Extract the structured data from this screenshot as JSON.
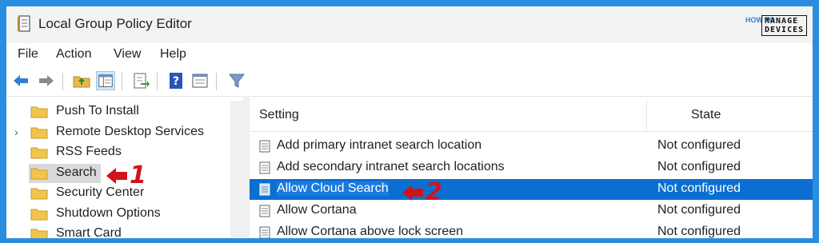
{
  "window": {
    "title": "Local Group Policy Editor",
    "brand_small": "HOW TO",
    "brand_box": "MANAGE DEVICES"
  },
  "menu": {
    "items": [
      "File",
      "Action",
      "View",
      "Help"
    ]
  },
  "toolbar": {
    "icons": [
      "back-arrow-icon",
      "forward-arrow-icon",
      "up-folder-icon",
      "show-hide-tree-icon",
      "export-list-icon",
      "help-icon",
      "properties-icon",
      "filter-icon"
    ]
  },
  "tree": {
    "items": [
      {
        "label": "Push To Install",
        "expandable": false,
        "selected": false
      },
      {
        "label": "Remote Desktop Services",
        "expandable": true,
        "selected": false
      },
      {
        "label": "RSS Feeds",
        "expandable": false,
        "selected": false
      },
      {
        "label": "Search",
        "expandable": false,
        "selected": true
      },
      {
        "label": "Security Center",
        "expandable": false,
        "selected": false
      },
      {
        "label": "Shutdown Options",
        "expandable": false,
        "selected": false
      },
      {
        "label": "Smart Card",
        "expandable": false,
        "selected": false
      }
    ]
  },
  "list": {
    "columns": {
      "setting": "Setting",
      "state": "State"
    },
    "rows": [
      {
        "setting": "Add primary intranet search location",
        "state": "Not configured",
        "selected": false
      },
      {
        "setting": "Add secondary intranet search locations",
        "state": "Not configured",
        "selected": false
      },
      {
        "setting": "Allow Cloud Search",
        "state": "Not configured",
        "selected": true
      },
      {
        "setting": "Allow Cortana",
        "state": "Not configured",
        "selected": false
      },
      {
        "setting": "Allow Cortana above lock screen",
        "state": "Not configured",
        "selected": false
      }
    ]
  },
  "annotations": {
    "callout_1": "1",
    "callout_2": "2"
  },
  "colors": {
    "frame": "#2b8de0",
    "selection": "#0a6fd1",
    "callout": "#d0141b"
  }
}
